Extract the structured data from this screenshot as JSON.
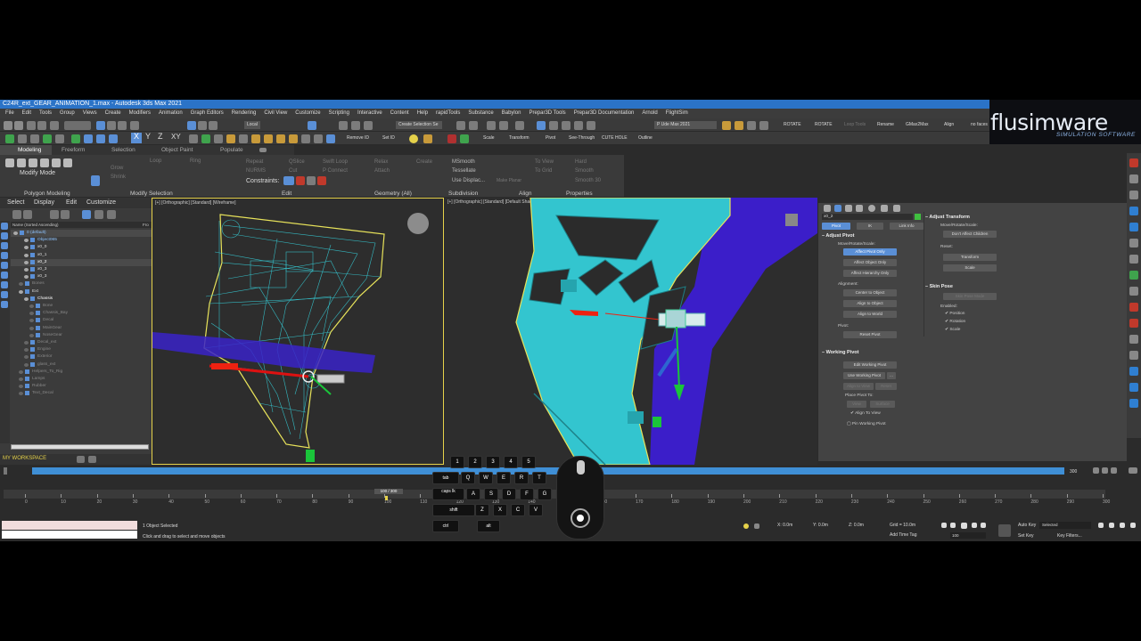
{
  "window": {
    "title": "C24R_ext_GEAR_ANIMATION_1.max - Autodesk 3ds Max 2021"
  },
  "menu": [
    "File",
    "Edit",
    "Tools",
    "Group",
    "Views",
    "Create",
    "Modifiers",
    "Animation",
    "Graph Editors",
    "Rendering",
    "Civil View",
    "Customize",
    "Scripting",
    "Interactive",
    "Content",
    "Help",
    "rapidTools",
    "Substance",
    "Babylon",
    "Prepar3D Tools",
    "Prepar3D Documentation",
    "Arnold",
    "FlightSim"
  ],
  "toolbar1": {
    "view_select": "Local",
    "selection_set": "Create Selection Se",
    "workspace": "P Ude Max 2021",
    "rotate1": "ROTATE",
    "rotate2": "ROTATE",
    "loop_tools": "Loop Tools",
    "rename": "Rename",
    "gmax": "GMax2Max",
    "align": "Align",
    "no_faces": "no faces"
  },
  "toolbar2": {
    "remove_id": "Remove ID",
    "set_id": "Set ID",
    "scale": "Scale",
    "transform": "Transform",
    "pivot": "Pivot",
    "see_through": "See-Through",
    "cute_hole": "CUTE HOLE",
    "outline": "Outline"
  },
  "ribbon": {
    "tabs": [
      "Modeling",
      "Freeform",
      "Selection",
      "Object Paint",
      "Populate"
    ],
    "modify_mode": "Modify Mode",
    "grow": "Grow",
    "shrink": "Shrink",
    "loop": "Loop",
    "ring": "Ring",
    "repeat": "Repeat",
    "quick_slice": "QSlice",
    "swift_loop": "Swift Loop",
    "nurms": "NURMS",
    "cut": "Cut",
    "p_connect": "P Connect",
    "constraints": "Constraints:",
    "relax": "Relax",
    "create": "Create",
    "attach": "Attach",
    "msmooth": "MSmooth",
    "tessellate": "Tessellate",
    "use_displac": "Use Displac...",
    "make_planar": "Make Planar",
    "to_view": "To View",
    "to_grid": "To Grid",
    "hard": "Hard",
    "smooth": "Smooth",
    "smooth30": "Smooth 30",
    "groups": [
      "Polygon Modeling",
      "Modify Selection",
      "Edit",
      "Geometry (All)",
      "Subdivision",
      "Align",
      "Properties"
    ]
  },
  "logo": {
    "name": "flusimware",
    "tagline": "SIMULATION SOFTWARE"
  },
  "scene_explorer": {
    "tabs": [
      "Select",
      "Display",
      "Edit",
      "Customize"
    ],
    "column": "Name (Sorted Ascending)",
    "column2": "Fro",
    "items": [
      {
        "label": "0 (default)",
        "indent": 0,
        "color": "#8fc4ff",
        "selected": true
      },
      {
        "label": "Object065",
        "indent": 2,
        "color": "#8fc4ff"
      },
      {
        "label": "x0_0",
        "indent": 2,
        "color": "#ddd"
      },
      {
        "label": "x0_1",
        "indent": 2,
        "color": "#ddd"
      },
      {
        "label": "x0_2",
        "indent": 2,
        "color": "#fff",
        "selected": true
      },
      {
        "label": "x0_3",
        "indent": 2,
        "color": "#ddd"
      },
      {
        "label": "x0_3",
        "indent": 2,
        "color": "#ddd"
      },
      {
        "label": "Bones",
        "indent": 1,
        "color": "#888"
      },
      {
        "label": "Ext",
        "indent": 1,
        "color": "#ddd"
      },
      {
        "label": "Chassis",
        "indent": 2,
        "color": "#fff"
      },
      {
        "label": "Bone",
        "indent": 3,
        "color": "#888"
      },
      {
        "label": "Chassis_Bay",
        "indent": 3,
        "color": "#888"
      },
      {
        "label": "Decal",
        "indent": 3,
        "color": "#888"
      },
      {
        "label": "MainGear",
        "indent": 3,
        "color": "#888"
      },
      {
        "label": "NoseGear",
        "indent": 3,
        "color": "#888"
      },
      {
        "label": "Decal_ext",
        "indent": 2,
        "color": "#888"
      },
      {
        "label": "Engine",
        "indent": 2,
        "color": "#888"
      },
      {
        "label": "Exterior",
        "indent": 2,
        "color": "#888"
      },
      {
        "label": "glass_ext",
        "indent": 2,
        "color": "#888"
      },
      {
        "label": "Helpers_To_Rig",
        "indent": 1,
        "color": "#888"
      },
      {
        "label": "Lamps",
        "indent": 1,
        "color": "#888"
      },
      {
        "label": "Rubber",
        "indent": 1,
        "color": "#888"
      },
      {
        "label": "Text_Decal",
        "indent": 1,
        "color": "#888"
      }
    ],
    "workspace": "MY WORKSPACE"
  },
  "viewport_left": {
    "label": "[+] [Orthographic] [Standard] [Wireframe]"
  },
  "viewport_right": {
    "label": "[+] [Orthographic] [Standard] [Default Shading]"
  },
  "command_panel": {
    "object_name": "x0_2",
    "tabs": [
      "Pivot",
      "IK",
      "Link Info"
    ],
    "adjust_pivot": "Adjust Pivot",
    "move_rotate_scale": "Move/Rotate/Scale:",
    "affect_pivot_only": "Affect Pivot Only",
    "affect_object_only": "Affect Object Only",
    "affect_hierarchy_only": "Affect Hierarchy Only",
    "alignment": "Alignment:",
    "center_to_object": "Center to Object",
    "align_to_object": "Align to Object",
    "align_to_world": "Align to World",
    "pivot": "Pivot:",
    "reset_pivot": "Reset Pivot",
    "working_pivot": "Working Pivot",
    "edit_working_pivot": "Edit Working Pivot",
    "use_working_pivot": "Use Working Pivot",
    "align_to_view": "Align to View",
    "reset": "Reset",
    "place_pivot_to": "Place Pivot To:",
    "view": "View",
    "surface": "Surface",
    "align_to_view_chk": "Align To View",
    "pin_working_pivot": "Pin Working Pivot",
    "adjust_transform": "Adjust Transform",
    "move_rotate_scale2": "Move/Rotate/Scale:",
    "dont_affect_children": "Don't Affect Children",
    "reset2": "Reset:",
    "transform": "Transform",
    "scale": "Scale",
    "skin_pose": "Skin Pose",
    "skin_pose_mode": "Skin Pose Mode",
    "enabled": "Enabled:",
    "position": "Position",
    "rotation": "Rotation",
    "scale_chk": "Scale"
  },
  "timeline": {
    "frame": "100 / 300",
    "ticks": [
      "0",
      "10",
      "20",
      "30",
      "40",
      "50",
      "60",
      "70",
      "80",
      "90",
      "100",
      "110",
      "120",
      "130",
      "140",
      "150",
      "160",
      "170",
      "180",
      "190",
      "200",
      "210",
      "220",
      "230",
      "240",
      "250",
      "260",
      "270",
      "280",
      "290",
      "300"
    ],
    "end_frame": "300",
    "status_count": "1 Object Selected",
    "status_prompt": "Click and drag to select and move objects",
    "x": "0.0m",
    "y": "0.0m",
    "z": "0.0m",
    "grid": "Grid = 10.0m",
    "add_time_tag": "Add Time Tag",
    "auto_key": "Auto Key",
    "set_key": "Set Key",
    "selected": "Selected",
    "key_filters": "Key Filters...",
    "frame_input": "100"
  },
  "keyboard": {
    "row1": [
      "1",
      "2",
      "3",
      "4",
      "5"
    ],
    "row2": [
      "tab",
      "Q",
      "W",
      "E",
      "R",
      "T"
    ],
    "row3": [
      "caps lk",
      "A",
      "S",
      "D",
      "F",
      "G"
    ],
    "row4": [
      "shift",
      "Z",
      "X",
      "C",
      "V"
    ],
    "row5": [
      "ctrl",
      "alt"
    ]
  },
  "colors": {
    "titlebar": "#2b73c7",
    "accent": "#5a8fd6",
    "mesh": "#33c4cc",
    "pivot_green": "#2ea82e",
    "axis_blue": "#3a2ad0"
  }
}
